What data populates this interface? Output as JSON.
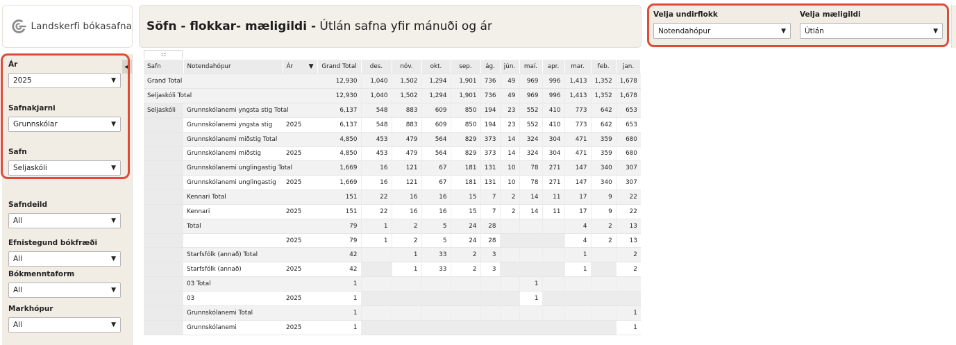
{
  "logo": {
    "text": "Landskerfi bókasafna",
    "icon": "landskerfi-logo-icon",
    "color": "#8a8a8a"
  },
  "header": {
    "title_bold": "Söfn - flokkar- mæligildi -",
    "title_rest": "Útlán safna yfir mánuði og ár"
  },
  "top_selectors": {
    "subgroup_label": "Velja undirflokk",
    "subgroup_value": "Notendahópur",
    "measure_label": "Velja mæligildi",
    "measure_value": "Útlán"
  },
  "accent_color": "#dd4b39",
  "sidebar": {
    "filters": [
      {
        "label": "Ár",
        "value": "2025"
      },
      {
        "label": "Safnakjarni",
        "value": "Grunnskólar"
      },
      {
        "label": "Safn",
        "value": "Seljaskóli"
      },
      {
        "label": "Safndeild",
        "value": "All"
      },
      {
        "label": "Efnistegund bókfræði",
        "value": "All"
      },
      {
        "label": "Bókmenntaform",
        "value": "All"
      },
      {
        "label": "Markhópur",
        "value": "All"
      }
    ],
    "collapse_icon": "chevron-left-icon"
  },
  "table": {
    "handle": "::::",
    "headers": {
      "safn": "Safn",
      "group": "Notendahópur",
      "year": "Ár",
      "total": "Grand Total",
      "months": [
        "des.",
        "nóv.",
        "okt.",
        "sep.",
        "ág.",
        "jún.",
        "maí.",
        "apr.",
        "mar.",
        "feb.",
        "jan."
      ]
    },
    "rows": [
      {
        "safn": "Grand Total",
        "group": "",
        "year": "",
        "total": "12,930",
        "months": [
          "1,040",
          "1,502",
          "1,294",
          "1,901",
          "736",
          "49",
          "969",
          "996",
          "1,413",
          "1,352",
          "1,678"
        ],
        "span": true
      },
      {
        "safn": "Seljaskóli Total",
        "group": "",
        "year": "",
        "total": "12,930",
        "months": [
          "1,040",
          "1,502",
          "1,294",
          "1,901",
          "736",
          "49",
          "969",
          "996",
          "1,413",
          "1,352",
          "1,678"
        ],
        "span": true
      },
      {
        "safn": "Seljaskóli",
        "group": "Grunnskólanemi yngsta stig Total",
        "year": "",
        "total": "6,137",
        "months": [
          "548",
          "883",
          "609",
          "850",
          "194",
          "23",
          "552",
          "410",
          "773",
          "642",
          "653"
        ],
        "span_group": true
      },
      {
        "safn": "",
        "group": "Grunnskólanemi yngsta stig",
        "year": "2025",
        "total": "6,137",
        "months": [
          "548",
          "883",
          "609",
          "850",
          "194",
          "23",
          "552",
          "410",
          "773",
          "642",
          "653"
        ]
      },
      {
        "safn": "",
        "group": "Grunnskólanemi miðstig Total",
        "year": "",
        "total": "4,850",
        "months": [
          "453",
          "479",
          "564",
          "829",
          "373",
          "14",
          "324",
          "304",
          "471",
          "359",
          "680"
        ],
        "span_group": true
      },
      {
        "safn": "",
        "group": "Grunnskólanemi miðstig",
        "year": "2025",
        "total": "4,850",
        "months": [
          "453",
          "479",
          "564",
          "829",
          "373",
          "14",
          "324",
          "304",
          "471",
          "359",
          "680"
        ]
      },
      {
        "safn": "",
        "group": "Grunnskólanemi unglingastig Total",
        "year": "",
        "total": "1,669",
        "months": [
          "16",
          "121",
          "67",
          "181",
          "131",
          "10",
          "78",
          "271",
          "147",
          "340",
          "307"
        ],
        "span_group": true
      },
      {
        "safn": "",
        "group": "Grunnskólanemi unglingastig",
        "year": "2025",
        "total": "1,669",
        "months": [
          "16",
          "121",
          "67",
          "181",
          "131",
          "10",
          "78",
          "271",
          "147",
          "340",
          "307"
        ]
      },
      {
        "safn": "",
        "group": "Kennari Total",
        "year": "",
        "total": "151",
        "months": [
          "22",
          "16",
          "16",
          "15",
          "7",
          "2",
          "14",
          "11",
          "17",
          "9",
          "22"
        ],
        "span_group": true
      },
      {
        "safn": "",
        "group": "Kennari",
        "year": "2025",
        "total": "151",
        "months": [
          "22",
          "16",
          "16",
          "15",
          "7",
          "2",
          "14",
          "11",
          "17",
          "9",
          "22"
        ]
      },
      {
        "safn": "",
        "group": "Total",
        "year": "",
        "total": "79",
        "months": [
          "1",
          "2",
          "5",
          "24",
          "28",
          "",
          "",
          "",
          "4",
          "2",
          "13"
        ],
        "span_group": true
      },
      {
        "safn": "",
        "group": "",
        "year": "2025",
        "total": "79",
        "months": [
          "1",
          "2",
          "5",
          "24",
          "28",
          "",
          "",
          "",
          "4",
          "2",
          "13"
        ]
      },
      {
        "safn": "",
        "group": "Starfsfólk (annað) Total",
        "year": "",
        "total": "42",
        "months": [
          "",
          "1",
          "33",
          "2",
          "3",
          "",
          "",
          "",
          "1",
          "",
          "2"
        ],
        "span_group": true
      },
      {
        "safn": "",
        "group": "Starfsfólk (annað)",
        "year": "2025",
        "total": "42",
        "months": [
          "",
          "1",
          "33",
          "2",
          "3",
          "",
          "",
          "",
          "1",
          "",
          "2"
        ]
      },
      {
        "safn": "",
        "group": "03 Total",
        "year": "",
        "total": "1",
        "months": [
          "",
          "",
          "",
          "",
          "",
          "",
          "1",
          "",
          "",
          "",
          ""
        ],
        "span_group": true
      },
      {
        "safn": "",
        "group": "03",
        "year": "2025",
        "total": "1",
        "months": [
          "",
          "",
          "",
          "",
          "",
          "",
          "1",
          "",
          "",
          "",
          ""
        ]
      },
      {
        "safn": "",
        "group": "Grunnskólanemi Total",
        "year": "",
        "total": "1",
        "months": [
          "",
          "",
          "",
          "",
          "",
          "",
          "",
          "",
          "",
          "",
          "1"
        ],
        "span_group": true
      },
      {
        "safn": "",
        "group": "Grunnskólanemi",
        "year": "2025",
        "total": "1",
        "months": [
          "",
          "",
          "",
          "",
          "",
          "",
          "",
          "",
          "",
          "",
          "1"
        ]
      }
    ]
  }
}
